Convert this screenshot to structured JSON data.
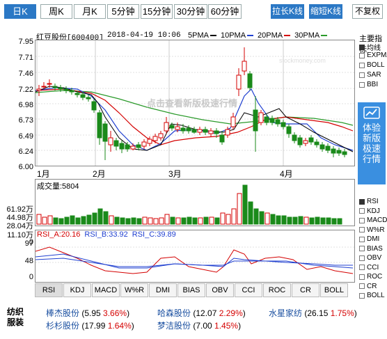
{
  "period_tabs": [
    "日K",
    "周K",
    "月K",
    "5分钟",
    "15分钟",
    "30分钟",
    "60分钟"
  ],
  "toolbar": {
    "zoom_out": "拉长K线",
    "zoom_in": "缩短K线",
    "adjust": "不复权"
  },
  "stock": {
    "name": "红豆股份[600400]",
    "datetime": "2018-04-19 10:06"
  },
  "ma_legend": [
    {
      "label": "5PMA",
      "color": "#000000"
    },
    {
      "label": "10PMA",
      "color": "#1f3fd0"
    },
    {
      "label": "20PMA",
      "color": "#d40000"
    },
    {
      "label": "30PMA",
      "color": "#2a9a2a"
    }
  ],
  "watermark": "点击查看新版极速行情",
  "site_watermark": "stockmoney.com",
  "price_axis": [
    "7.95",
    "7.71",
    "7.46",
    "7.22",
    "6.98",
    "6.73",
    "6.49",
    "6.24",
    "6.00"
  ],
  "month_labels": [
    "1月",
    "2月",
    "3月",
    "4月"
  ],
  "volume": {
    "title": "成交量:5804",
    "axis": [
      "61.92万",
      "44.98万",
      "28.04万",
      "11.10万",
      "0"
    ]
  },
  "rsi": {
    "a_label": "RSI_A:20.16",
    "b_label": "RSI_B:33.92",
    "c_label": "RSI_C:39.89",
    "axis": [
      "97",
      "48",
      "0"
    ]
  },
  "indicator_tabs": [
    "RSI",
    "KDJ",
    "MACD",
    "W%R",
    "DMI",
    "BIAS",
    "OBV",
    "CCI",
    "ROC",
    "CR",
    "BOLL"
  ],
  "side": {
    "title": "主要指标",
    "main_items": [
      {
        "label": "均线",
        "checked": true
      },
      {
        "label": "EXPMA",
        "checked": false
      },
      {
        "label": "BOLL",
        "checked": false
      },
      {
        "label": "SAR",
        "checked": false
      },
      {
        "label": "BBI",
        "checked": false
      }
    ],
    "promo": "体验新版极速行情",
    "sub_items": [
      {
        "label": "RSI",
        "checked": true
      },
      {
        "label": "KDJ",
        "checked": false
      },
      {
        "label": "MACD",
        "checked": false
      },
      {
        "label": "W%R",
        "checked": false
      },
      {
        "label": "DMI",
        "checked": false
      },
      {
        "label": "BIAS",
        "checked": false
      },
      {
        "label": "OBV",
        "checked": false
      },
      {
        "label": "CCI",
        "checked": false
      },
      {
        "label": "ROC",
        "checked": false
      },
      {
        "label": "CR",
        "checked": false
      },
      {
        "label": "BOLL",
        "checked": false
      }
    ]
  },
  "related": {
    "sector": "纺织服装",
    "items": [
      {
        "name": "棒杰股份",
        "price": "5.95",
        "pct": "3.66%"
      },
      {
        "name": "哈森股份",
        "price": "12.07",
        "pct": "2.29%"
      },
      {
        "name": "水星家纺",
        "price": "26.15",
        "pct": "1.75%"
      },
      {
        "name": "杉杉股份",
        "price": "17.99",
        "pct": "1.64%"
      },
      {
        "name": "梦洁股份",
        "price": "7.00",
        "pct": "1.45%"
      }
    ]
  }
}
